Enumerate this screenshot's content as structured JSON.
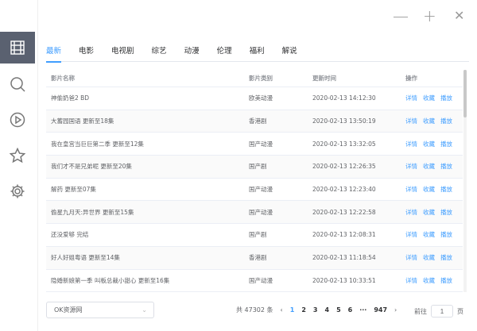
{
  "window": {
    "minimize": "—",
    "maximize": "+",
    "close": "✕"
  },
  "sidebar": [
    "grid-icon",
    "search-icon",
    "play-icon",
    "star-icon",
    "gear-icon"
  ],
  "tabs": [
    "最新",
    "电影",
    "电视剧",
    "综艺",
    "动漫",
    "伦理",
    "福利",
    "解说"
  ],
  "table": {
    "headers": [
      "影片名称",
      "影片类别",
      "更新时间",
      "操作"
    ],
    "actions": [
      "详情",
      "收藏",
      "播放"
    ],
    "rows": [
      {
        "name": "神偷奶爸2 BD",
        "type": "欧美动漫",
        "time": "2020-02-13 14:12:30"
      },
      {
        "name": "大蓄园国语 更新至18集",
        "type": "香港剧",
        "time": "2020-02-13 13:50:19"
      },
      {
        "name": "我在皇宫当巨巨第二季 更新至12集",
        "type": "国产动漫",
        "time": "2020-02-13 13:32:05"
      },
      {
        "name": "我们才不是兄弟呢 更新至20集",
        "type": "国产剧",
        "time": "2020-02-13 12:26:35"
      },
      {
        "name": "解药 更新至07集",
        "type": "国产动漫",
        "time": "2020-02-13 12:23:40"
      },
      {
        "name": "偷星九月天:异世界 更新至15集",
        "type": "国产动漫",
        "time": "2020-02-13 12:22:58"
      },
      {
        "name": "还没爱够 完结",
        "type": "国产剧",
        "time": "2020-02-13 12:08:31"
      },
      {
        "name": "好人好姐粤语 更新至14集",
        "type": "香港剧",
        "time": "2020-02-13 11:18:54"
      },
      {
        "name": "隐婚新娘第一季 叫板总裁小甜心 更新至16集",
        "type": "国产动漫",
        "time": "2020-02-13 10:33:51"
      }
    ]
  },
  "footer": {
    "source": "OK资源网",
    "total": "共 47302 条",
    "prev": "‹",
    "pages": [
      "1",
      "2",
      "3",
      "4",
      "5",
      "6",
      "···",
      "947"
    ],
    "next": "›",
    "goto_label": "前往",
    "goto_value": "1",
    "page_unit": "页"
  }
}
